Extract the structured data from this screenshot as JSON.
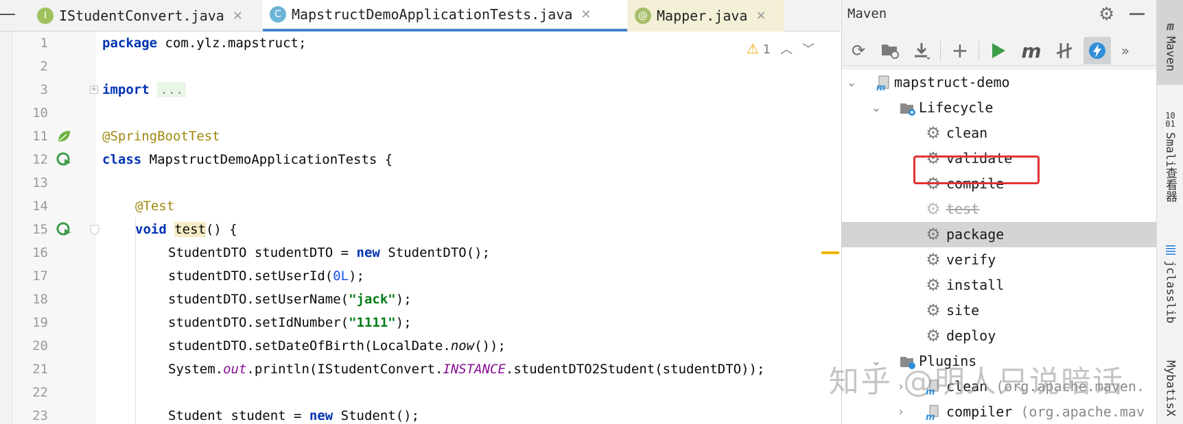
{
  "tabs": [
    {
      "icon": "I",
      "label": "IStudentConvert.java"
    },
    {
      "icon": "C",
      "label": "MapstructDemoApplicationTests.java"
    },
    {
      "icon": "@",
      "label": "Mapper.java"
    }
  ],
  "tab_close": "✕",
  "editor": {
    "inspection_count": "1",
    "lines": [
      {
        "num": "1"
      },
      {
        "num": "2"
      },
      {
        "num": "3"
      },
      {
        "num": "10"
      },
      {
        "num": "11"
      },
      {
        "num": "12"
      },
      {
        "num": "13"
      },
      {
        "num": "14"
      },
      {
        "num": "15"
      },
      {
        "num": "16"
      },
      {
        "num": "17"
      },
      {
        "num": "18"
      },
      {
        "num": "19"
      },
      {
        "num": "20"
      },
      {
        "num": "21"
      },
      {
        "num": "22"
      },
      {
        "num": "23"
      }
    ],
    "tokens": {
      "l1_kw": "package",
      "l1_rest": " com.ylz.mapstruct;",
      "l3_kw": "import",
      "l3_fold": "...",
      "l11_ann": "@SpringBootTest",
      "l12_kw": "class",
      "l12_rest": " MapstructDemoApplicationTests {",
      "l14_ann": "@Test",
      "l15_kw": "void",
      "l15_method": "test",
      "l15_rest": "() {",
      "l16_a": "StudentDTO studentDTO = ",
      "l16_kw": "new",
      "l16_b": " StudentDTO();",
      "l17_a": "studentDTO.setUserId(",
      "l17_num": "0L",
      "l17_b": ");",
      "l18_a": "studentDTO.setUserName(",
      "l18_str": "\"jack\"",
      "l18_b": ");",
      "l19_a": "studentDTO.setIdNumber(",
      "l19_str": "\"1111\"",
      "l19_b": ");",
      "l20_a": "studentDTO.setDateOfBirth(LocalDate.",
      "l20_static": "now",
      "l20_b": "());",
      "l21_a": "System.",
      "l21_field": "out",
      "l21_b": ".println(IStudentConvert.",
      "l21_field2": "INSTANCE",
      "l21_c": ".studentDTO2Student(studentDTO));",
      "l23_a": "Student student = ",
      "l23_kw": "new",
      "l23_b": " Student();"
    }
  },
  "maven": {
    "title": "Maven",
    "project": "mapstruct-demo",
    "lifecycle_label": "Lifecycle",
    "lifecycle": [
      "clean",
      "validate",
      "compile",
      "test",
      "package",
      "verify",
      "install",
      "site",
      "deploy"
    ],
    "plugins_label": "Plugins",
    "plugins": [
      {
        "name": "clean",
        "detail": "(org.apache.maven."
      },
      {
        "name": "compiler",
        "detail": "(org.apache.mav"
      }
    ],
    "selected": "package",
    "highlighted": "compile",
    "skipped": "test"
  },
  "side_tabs": [
    "Maven",
    "Smali查看器",
    "jclasslib",
    "MybatisX"
  ],
  "watermark": "知乎 @明人只说暗话",
  "colors": {
    "keyword": "#0033b3",
    "annotation": "#9e880d",
    "string": "#067d17",
    "highlight_box": "#e03232",
    "accent": "#4083c9"
  }
}
